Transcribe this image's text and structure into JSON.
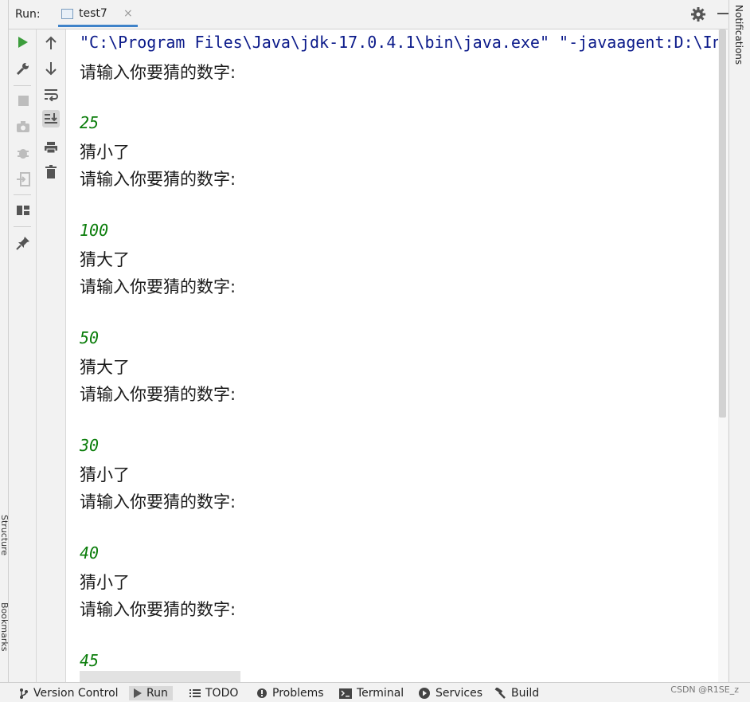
{
  "outer_left": {
    "structure_label": "Structure",
    "bookmarks_label": "Bookmarks"
  },
  "header": {
    "run_label": "Run:",
    "tab_label": "test7",
    "tab_close": "×"
  },
  "console": {
    "command": "\"C:\\Program Files\\Java\\jdk-17.0.4.1\\bin\\java.exe\" \"-javaagent:D:\\Int",
    "lines": [
      {
        "kind": "out",
        "text": "请输入你要猜的数字:"
      },
      {
        "kind": "inp",
        "text": "25"
      },
      {
        "kind": "out",
        "text": "猜小了"
      },
      {
        "kind": "out",
        "text": "请输入你要猜的数字:"
      },
      {
        "kind": "inp",
        "text": "100"
      },
      {
        "kind": "out",
        "text": "猜大了"
      },
      {
        "kind": "out",
        "text": "请输入你要猜的数字:"
      },
      {
        "kind": "inp",
        "text": "50"
      },
      {
        "kind": "out",
        "text": "猜大了"
      },
      {
        "kind": "out",
        "text": "请输入你要猜的数字:"
      },
      {
        "kind": "inp",
        "text": "30"
      },
      {
        "kind": "out",
        "text": "猜小了"
      },
      {
        "kind": "out",
        "text": "请输入你要猜的数字:"
      },
      {
        "kind": "inp",
        "text": "40"
      },
      {
        "kind": "out",
        "text": "猜小了"
      },
      {
        "kind": "out",
        "text": "请输入你要猜的数字:"
      },
      {
        "kind": "inp",
        "text": "45"
      }
    ]
  },
  "notifications_label": "Notifications",
  "status_bar": {
    "items": [
      {
        "label": "Version Control",
        "icon": "branch-icon"
      },
      {
        "label": "Run",
        "icon": "run-icon",
        "active": true
      },
      {
        "label": "TODO",
        "icon": "list-icon"
      },
      {
        "label": "Problems",
        "icon": "problems-icon"
      },
      {
        "label": "Terminal",
        "icon": "terminal-icon"
      },
      {
        "label": "Services",
        "icon": "services-icon"
      },
      {
        "label": "Build",
        "icon": "hammer-icon"
      }
    ],
    "watermark": "CSDN @R1SE_z"
  },
  "colors": {
    "accent": "#4083c9",
    "command_text": "#0b1a8a",
    "input_text": "#0a7d0a",
    "run_green": "#3c9d3c"
  }
}
